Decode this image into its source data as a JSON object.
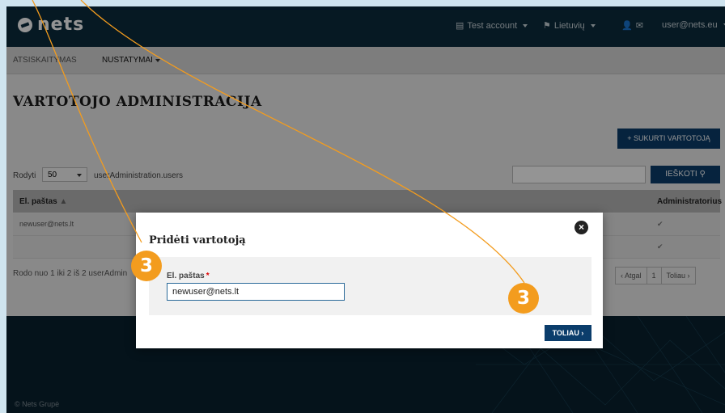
{
  "topbar": {
    "logo_text": "nets",
    "account_label": "Test account",
    "language_label": "Lietuvių",
    "user_email": "user@nets.eu"
  },
  "nav": {
    "items": [
      {
        "label": "ATSISKAITYMAS"
      },
      {
        "label": "NUSTATYMAI"
      }
    ]
  },
  "page": {
    "title": "VARTOTOJO ADMINISTRACIJA",
    "create_button": "+ SUKURTI VARTOTOJĄ",
    "show_label": "Rodyti",
    "page_size": "50",
    "users_label": "userAdministration.users",
    "search_placeholder": "",
    "search_button": "IEŠKOTI",
    "table": {
      "columns": [
        "El. paštas",
        "Administratorius"
      ],
      "rows": [
        {
          "email": "newuser@nets.lt",
          "admin": "✔"
        },
        {
          "email": "",
          "admin": "✔"
        }
      ]
    },
    "summary": "Rodo nuo 1 iki 2 iš 2 userAdmin",
    "pager": {
      "prev": "‹ Atgal",
      "page": "1",
      "next": "Toliau ›"
    }
  },
  "footer": {
    "text": "© Nets Grupė"
  },
  "modal": {
    "title": "Pridėti vartotoją",
    "field_label": "El. paštas",
    "required_mark": "*",
    "email_value": "newuser@nets.lt",
    "next_button": "TOLIAU ›"
  },
  "annotations": {
    "badge_left": "3",
    "badge_right": "3",
    "color": "#f39c1e"
  }
}
